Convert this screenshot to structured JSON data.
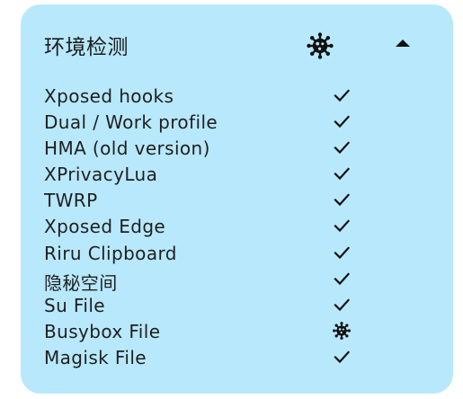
{
  "card": {
    "title": "环境检测",
    "status_icon": "virus-icon",
    "toggle_icon": "caret-up-icon",
    "background": "#b8e8fb"
  },
  "items": [
    {
      "label": "Xposed hooks",
      "result": "check-icon"
    },
    {
      "label": "Dual / Work profile",
      "result": "check-icon"
    },
    {
      "label": "HMA (old version)",
      "result": "check-icon"
    },
    {
      "label": "XPrivacyLua",
      "result": "check-icon"
    },
    {
      "label": "TWRP",
      "result": "check-icon"
    },
    {
      "label": "Xposed Edge",
      "result": "check-icon"
    },
    {
      "label": "Riru Clipboard",
      "result": "check-icon"
    },
    {
      "label": "隐秘空间",
      "result": "check-icon"
    },
    {
      "label": "Su File",
      "result": "check-icon"
    },
    {
      "label": "Busybox File",
      "result": "virus-icon"
    },
    {
      "label": "Magisk File",
      "result": "check-icon"
    }
  ]
}
